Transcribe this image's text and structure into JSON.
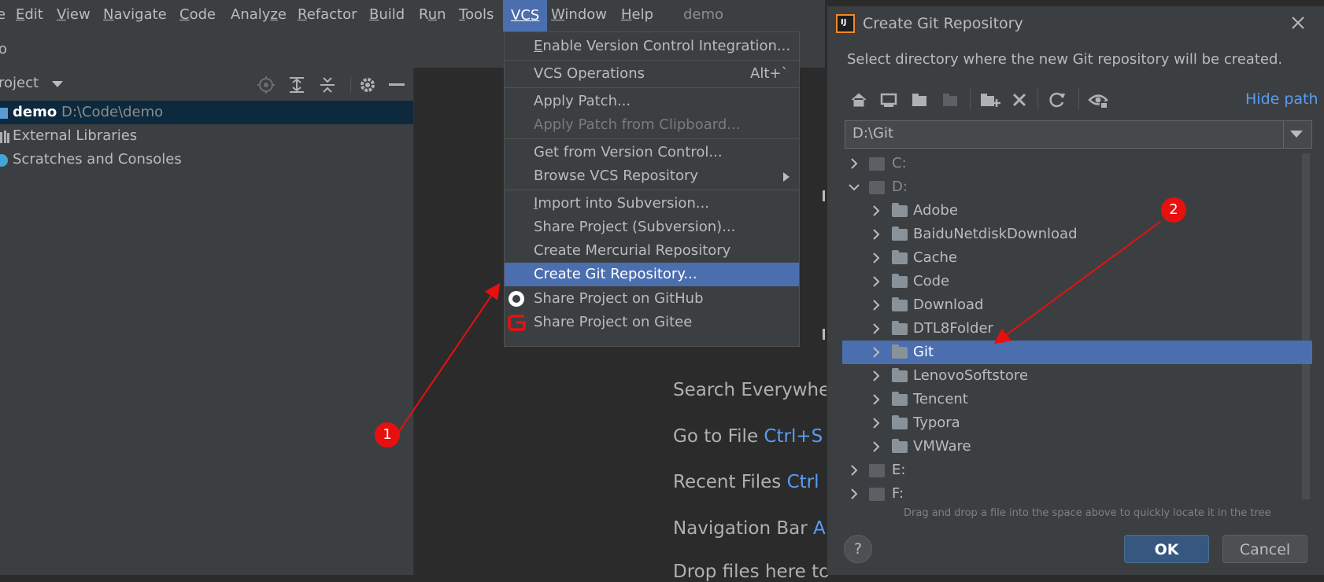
{
  "menubar": {
    "items": [
      {
        "pre": "",
        "mn": "E",
        "post": "dit"
      },
      {
        "pre": "",
        "mn": "V",
        "post": "iew"
      },
      {
        "pre": "",
        "mn": "N",
        "post": "avigate"
      },
      {
        "pre": "",
        "mn": "C",
        "post": "ode"
      },
      {
        "pre": "Analy",
        "mn": "z",
        "post": "e"
      },
      {
        "pre": "",
        "mn": "R",
        "post": "efactor"
      },
      {
        "pre": "",
        "mn": "B",
        "post": "uild"
      },
      {
        "pre": "R",
        "mn": "u",
        "post": "n"
      },
      {
        "pre": "",
        "mn": "T",
        "post": "ools"
      },
      {
        "pre": "",
        "mn": "VCS",
        "post": ""
      },
      {
        "pre": "",
        "mn": "W",
        "post": "indow"
      },
      {
        "pre": "",
        "mn": "H",
        "post": "elp"
      }
    ],
    "project_name": "demo"
  },
  "breadcrumb": "o",
  "project_panel": {
    "title": "roject",
    "tree": [
      {
        "label": "demo",
        "path": "D:\\Code\\demo"
      },
      {
        "label": "External Libraries"
      },
      {
        "label": "Scratches and Consoles"
      }
    ]
  },
  "editor_hints": [
    {
      "label": "Search Everywhe",
      "key": ""
    },
    {
      "label": "Go to File",
      "key": "Ctrl+S"
    },
    {
      "label": "Recent Files",
      "key": "Ctrl"
    },
    {
      "label": "Navigation Bar",
      "key": "A"
    },
    {
      "label": "Drop files here to",
      "key": ""
    }
  ],
  "vcs_menu": {
    "items": [
      {
        "pre": "",
        "mn": "E",
        "post": "nable Version Control Integration...",
        "shortcut": ""
      },
      {
        "pre": "VCS Operations",
        "mn": "",
        "post": "",
        "shortcut": "Alt+`"
      },
      {
        "pre": "Apply Patch...",
        "mn": "",
        "post": "",
        "shortcut": ""
      },
      {
        "pre": "Apply Patch from Clipboard...",
        "mn": "",
        "post": "",
        "shortcut": ""
      },
      {
        "pre": "Get from Version Control...",
        "mn": "",
        "post": "",
        "shortcut": ""
      },
      {
        "pre": "Browse VCS Repository",
        "mn": "",
        "post": "",
        "shortcut": ""
      },
      {
        "pre": "",
        "mn": "I",
        "post": "mport into Subversion...",
        "shortcut": ""
      },
      {
        "pre": "Share Project (Subversion)...",
        "mn": "",
        "post": "",
        "shortcut": ""
      },
      {
        "pre": "Create Mercurial Repository",
        "mn": "",
        "post": "",
        "shortcut": ""
      },
      {
        "pre": "Create Git Repository...",
        "mn": "",
        "post": "",
        "shortcut": ""
      },
      {
        "pre": "Share Project on GitHub",
        "mn": "",
        "post": "",
        "shortcut": ""
      },
      {
        "pre": "Share Project on Gitee",
        "mn": "",
        "post": "",
        "shortcut": ""
      }
    ]
  },
  "dialog": {
    "title": "Create Git Repository",
    "subtitle": "Select directory where the new Git repository will be created.",
    "hide_path": "Hide path",
    "path_value": "D:\\Git",
    "drives": [
      "C:",
      "D:",
      "E:",
      "F:"
    ],
    "folders": [
      "Adobe",
      "BaiduNetdiskDownload",
      "Cache",
      "Code",
      "Download",
      "DTL8Folder",
      "Git",
      "LenovoSoftstore",
      "Tencent",
      "Typora",
      "VMWare"
    ],
    "selected_folder": "Git",
    "hint": "Drag and drop a file into the space above to quickly locate it in the tree",
    "ok": "OK",
    "cancel": "Cancel",
    "help": "?"
  },
  "annotations": [
    "1",
    "2"
  ],
  "colors": {
    "accent": "#4b6eaf",
    "annotation": "#e8100f",
    "link": "#589df6"
  }
}
